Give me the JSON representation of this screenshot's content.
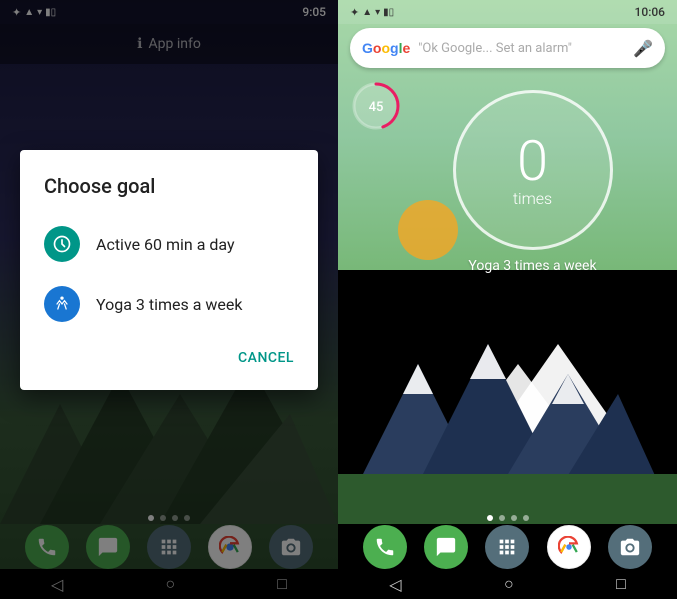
{
  "left_phone": {
    "status_bar": {
      "time": "9:05",
      "icons": [
        "bluetooth",
        "signal",
        "wifi",
        "battery"
      ]
    },
    "app_info": {
      "label": "App info"
    },
    "dialog": {
      "title": "Choose goal",
      "options": [
        {
          "id": "option-active",
          "label": "Active 60 min a day",
          "icon_color": "teal",
          "icon": "⏱"
        },
        {
          "id": "option-yoga",
          "label": "Yoga 3 times a week",
          "icon_color": "blue",
          "icon": "🏃"
        }
      ],
      "cancel_label": "CANCEL"
    },
    "page_dots": 4,
    "nav": [
      "◁",
      "○",
      "□"
    ]
  },
  "right_phone": {
    "status_bar": {
      "time": "10:06",
      "icons": [
        "bluetooth",
        "signal",
        "wifi",
        "battery"
      ]
    },
    "search_bar": {
      "google_letters": [
        "G",
        "o",
        "o",
        "g",
        "l",
        "e"
      ],
      "placeholder": "\"Ok Google... Set an alarm\"",
      "mic_label": "mic"
    },
    "progress_ring": {
      "value": 45,
      "max": 100,
      "label": "45"
    },
    "counter_widget": {
      "number": "0",
      "unit": "times",
      "label": "Yoga 3 times a week"
    },
    "page_dots": 4,
    "nav": [
      "◁",
      "○",
      "□"
    ]
  },
  "dock_icons": {
    "phone": "📞",
    "hangouts": "💬",
    "apps": "⠿",
    "chrome": "🌐",
    "camera": "📷"
  }
}
